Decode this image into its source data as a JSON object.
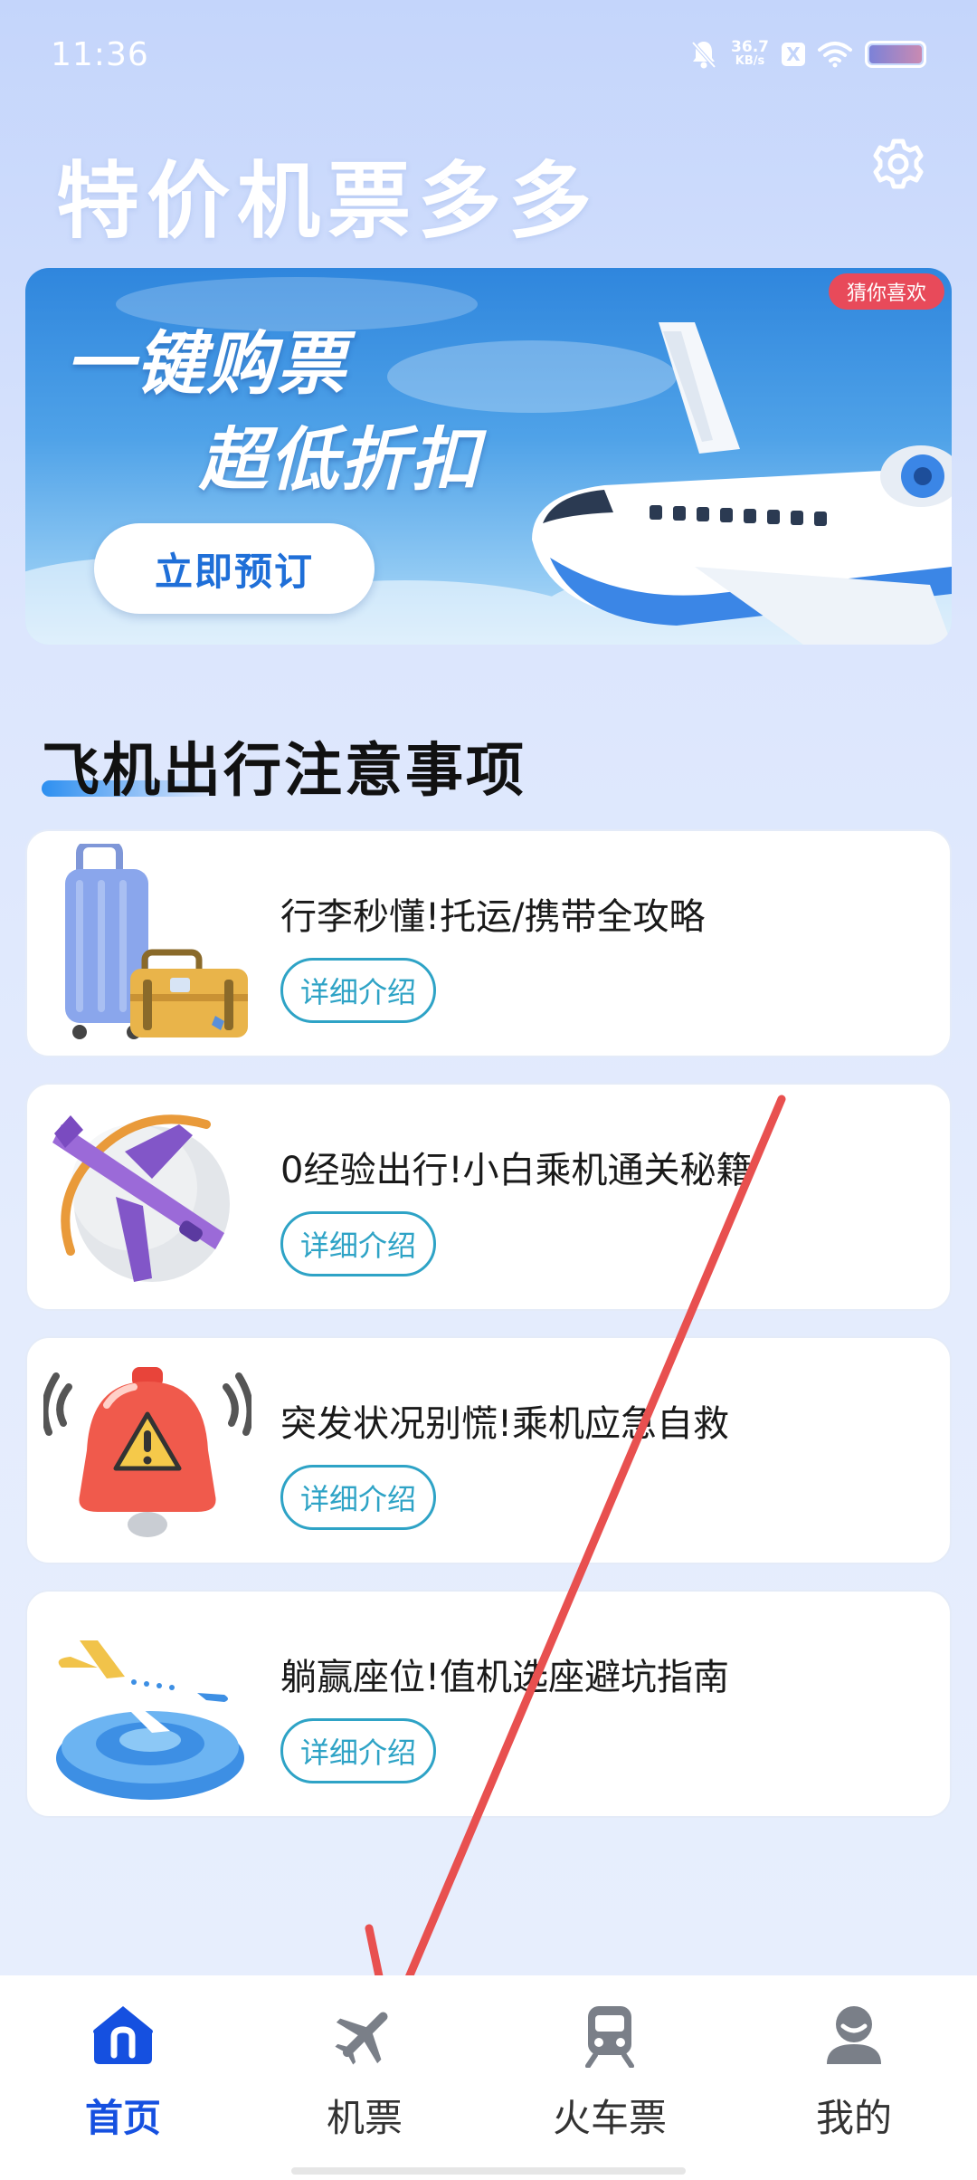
{
  "status_bar": {
    "time": "11:36",
    "net_speed": "36.7",
    "net_unit": "KB/s",
    "x_badge": "X",
    "icons": [
      "bell-muted-icon",
      "x-badge-icon",
      "wifi-icon",
      "battery-icon"
    ]
  },
  "header": {
    "title": "特价机票多多",
    "settings_icon": "gear-icon"
  },
  "banner": {
    "tag": "猜你喜欢",
    "headline_1": "一键购票",
    "headline_2": "超低折扣",
    "button_label": "立即预订"
  },
  "section": {
    "title": "飞机出行注意事项",
    "accent": "#2d8ff0"
  },
  "cards": [
    {
      "title": "行李秒懂!托运/携带全攻略",
      "button": "详细介绍",
      "icon": "luggage-icon"
    },
    {
      "title": "0经验出行!小白乘机通关秘籍",
      "button": "详细介绍",
      "icon": "airplane-globe-icon"
    },
    {
      "title": "突发状况别慌!乘机应急自救",
      "button": "详细介绍",
      "icon": "alarm-bell-icon"
    },
    {
      "title": "躺赢座位!值机选座避坑指南",
      "button": "详细介绍",
      "icon": "airplane-seat-icon"
    }
  ],
  "tabbar": {
    "active_color": "#1550e0",
    "items": [
      {
        "label": "首页",
        "icon": "home-icon",
        "active": true
      },
      {
        "label": "机票",
        "icon": "airplane-icon",
        "active": false
      },
      {
        "label": "火车票",
        "icon": "train-icon",
        "active": false
      },
      {
        "label": "我的",
        "icon": "user-icon",
        "active": false
      }
    ]
  },
  "annotation": {
    "color": "#e8504f",
    "shape": "arrow"
  }
}
